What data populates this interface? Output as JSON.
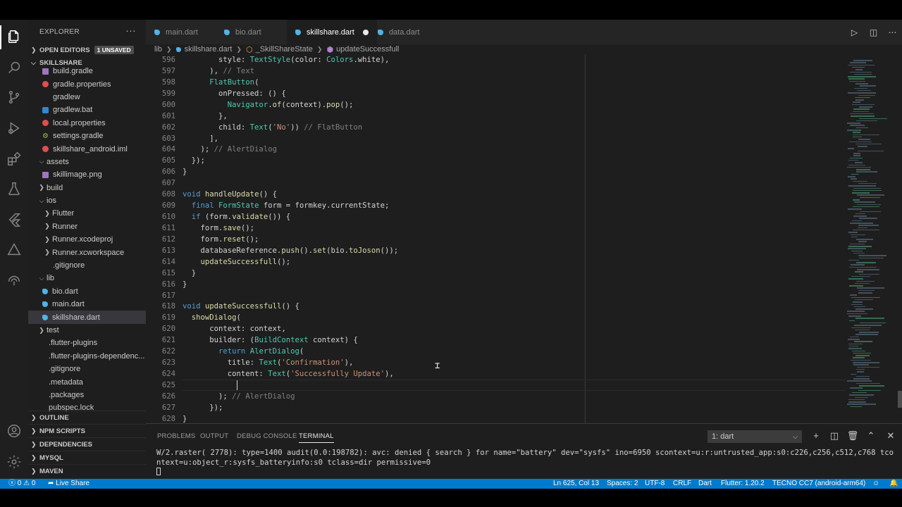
{
  "sidebar": {
    "title": "EXPLORER",
    "more": "···",
    "open_editors": {
      "label": "OPEN EDITORS",
      "badge": "1 UNSAVED"
    },
    "project": "SKILLSHARE",
    "tree": [
      {
        "label": "build.gradle",
        "icon": "gradle-icon",
        "depth": 2
      },
      {
        "label": "gradle.properties",
        "icon": "properties-icon",
        "depth": 2
      },
      {
        "label": "gradlew",
        "icon": "file-icon",
        "depth": 2
      },
      {
        "label": "gradlew.bat",
        "icon": "bat-icon",
        "depth": 2
      },
      {
        "label": "local.properties",
        "icon": "properties-icon",
        "depth": 2
      },
      {
        "label": "settings.gradle",
        "icon": "gear-icon",
        "depth": 2
      },
      {
        "label": "skillshare_android.iml",
        "icon": "iml-icon",
        "depth": 2
      },
      {
        "label": "assets",
        "icon": "folder-open-chevron",
        "depth": 1
      },
      {
        "label": "skillimage.png",
        "icon": "image-icon",
        "depth": 2
      },
      {
        "label": "build",
        "icon": "folder-closed-chevron",
        "depth": 1
      },
      {
        "label": "ios",
        "icon": "folder-open-chevron",
        "depth": 1
      },
      {
        "label": "Flutter",
        "icon": "folder-closed-chevron",
        "depth": 2
      },
      {
        "label": "Runner",
        "icon": "folder-closed-chevron",
        "depth": 2
      },
      {
        "label": "Runner.xcodeproj",
        "icon": "folder-closed-chevron",
        "depth": 2
      },
      {
        "label": "Runner.xcworkspace",
        "icon": "folder-closed-chevron",
        "depth": 2
      },
      {
        "label": ".gitignore",
        "icon": "file-icon",
        "depth": 2
      },
      {
        "label": "lib",
        "icon": "folder-open-chevron",
        "depth": 1
      },
      {
        "label": "bio.dart",
        "icon": "dart-icon",
        "depth": 2
      },
      {
        "label": "main.dart",
        "icon": "dart-icon",
        "depth": 2
      },
      {
        "label": "skillshare.dart",
        "icon": "dart-icon",
        "depth": 2,
        "selected": true
      },
      {
        "label": "test",
        "icon": "folder-closed-chevron",
        "depth": 1
      },
      {
        "label": ".flutter-plugins",
        "icon": "file-icon",
        "depth": 1
      },
      {
        "label": ".flutter-plugins-dependenc...",
        "icon": "file-icon",
        "depth": 1
      },
      {
        "label": ".gitignore",
        "icon": "file-icon",
        "depth": 1
      },
      {
        "label": ".metadata",
        "icon": "file-icon",
        "depth": 1
      },
      {
        "label": ".packages",
        "icon": "file-icon",
        "depth": 1
      },
      {
        "label": "pubspec.lock",
        "icon": "file-icon",
        "depth": 1
      }
    ],
    "sections": [
      "OUTLINE",
      "NPM SCRIPTS",
      "DEPENDENCIES",
      "MYSQL",
      "MAVEN"
    ]
  },
  "tabs": [
    {
      "label": "main.dart",
      "active": false
    },
    {
      "label": "bio.dart",
      "active": false
    },
    {
      "label": "skillshare.dart",
      "active": true,
      "dirty": true
    },
    {
      "label": "data.dart",
      "active": false
    }
  ],
  "breadcrumb": [
    "lib",
    "skillshare.dart",
    "_SkillShareState",
    "updateSuccessfull"
  ],
  "editor": {
    "lines": [
      {
        "n": "596",
        "t": [
          [
            "        style: ",
            ""
          ],
          [
            "TextStyle",
            "ty"
          ],
          [
            "(color: ",
            ""
          ],
          [
            "Colors",
            "ty"
          ],
          [
            ".white),",
            ""
          ]
        ]
      },
      {
        "n": "597",
        "t": [
          [
            "      ), ",
            ""
          ],
          [
            "// Text",
            "cmh"
          ]
        ]
      },
      {
        "n": "598",
        "t": [
          [
            "      ",
            ""
          ],
          [
            "FlatButton",
            "ty"
          ],
          [
            "(",
            ""
          ]
        ]
      },
      {
        "n": "599",
        "t": [
          [
            "        onPressed: () {",
            ""
          ]
        ]
      },
      {
        "n": "600",
        "t": [
          [
            "          ",
            ""
          ],
          [
            "Navigator",
            "ty"
          ],
          [
            ".",
            ""
          ],
          [
            "of",
            "fn"
          ],
          [
            "(context).",
            ""
          ],
          [
            "pop",
            "fn"
          ],
          [
            "();",
            ""
          ]
        ]
      },
      {
        "n": "601",
        "t": [
          [
            "        },",
            ""
          ]
        ]
      },
      {
        "n": "602",
        "t": [
          [
            "        child: ",
            ""
          ],
          [
            "Text",
            "ty"
          ],
          [
            "(",
            ""
          ],
          [
            "'No'",
            "st"
          ],
          [
            ")) ",
            ""
          ],
          [
            "// FlatButton",
            "cmh"
          ]
        ]
      },
      {
        "n": "603",
        "t": [
          [
            "      ],",
            ""
          ]
        ]
      },
      {
        "n": "604",
        "t": [
          [
            "    ); ",
            ""
          ],
          [
            "// AlertDialog",
            "cmh"
          ]
        ]
      },
      {
        "n": "605",
        "t": [
          [
            "  });",
            ""
          ]
        ]
      },
      {
        "n": "606",
        "t": [
          [
            "}",
            ""
          ]
        ]
      },
      {
        "n": "607",
        "t": [
          [
            "",
            ""
          ]
        ]
      },
      {
        "n": "608",
        "t": [
          [
            "void",
            "kw"
          ],
          [
            " ",
            ""
          ],
          [
            "handleUpdate",
            "fn"
          ],
          [
            "() {",
            ""
          ]
        ]
      },
      {
        "n": "609",
        "t": [
          [
            "  ",
            ""
          ],
          [
            "final",
            "kw"
          ],
          [
            " ",
            ""
          ],
          [
            "FormState",
            "ty"
          ],
          [
            " form = formkey.currentState;",
            ""
          ]
        ]
      },
      {
        "n": "610",
        "t": [
          [
            "  ",
            ""
          ],
          [
            "if",
            "kw"
          ],
          [
            " (form.",
            ""
          ],
          [
            "validate",
            "fn"
          ],
          [
            "()) {",
            ""
          ]
        ]
      },
      {
        "n": "611",
        "t": [
          [
            "    form.",
            ""
          ],
          [
            "save",
            "fn"
          ],
          [
            "();",
            ""
          ]
        ]
      },
      {
        "n": "612",
        "t": [
          [
            "    form.",
            ""
          ],
          [
            "reset",
            "fn"
          ],
          [
            "();",
            ""
          ]
        ]
      },
      {
        "n": "613",
        "t": [
          [
            "    databaseReference.",
            ""
          ],
          [
            "push",
            "fn"
          ],
          [
            "().",
            ""
          ],
          [
            "set",
            "fn"
          ],
          [
            "(bio.",
            ""
          ],
          [
            "toJoson",
            "fn"
          ],
          [
            "());",
            ""
          ]
        ]
      },
      {
        "n": "614",
        "t": [
          [
            "    ",
            ""
          ],
          [
            "updateSuccessfull",
            "fn"
          ],
          [
            "();",
            ""
          ]
        ]
      },
      {
        "n": "615",
        "t": [
          [
            "  }",
            ""
          ]
        ]
      },
      {
        "n": "616",
        "t": [
          [
            "}",
            ""
          ]
        ]
      },
      {
        "n": "617",
        "t": [
          [
            "",
            ""
          ]
        ]
      },
      {
        "n": "618",
        "t": [
          [
            "void",
            "kw"
          ],
          [
            " ",
            ""
          ],
          [
            "updateSuccessfull",
            "fn"
          ],
          [
            "() {",
            ""
          ]
        ]
      },
      {
        "n": "619",
        "t": [
          [
            "  ",
            ""
          ],
          [
            "showDialog",
            "fn"
          ],
          [
            "(",
            ""
          ]
        ]
      },
      {
        "n": "620",
        "t": [
          [
            "      context: context,",
            ""
          ]
        ]
      },
      {
        "n": "621",
        "t": [
          [
            "      builder: (",
            ""
          ],
          [
            "BuildContext",
            "ty"
          ],
          [
            " context) {",
            ""
          ]
        ]
      },
      {
        "n": "622",
        "t": [
          [
            "        ",
            ""
          ],
          [
            "return",
            "kw"
          ],
          [
            " ",
            ""
          ],
          [
            "AlertDialog",
            "ty"
          ],
          [
            "(",
            ""
          ]
        ]
      },
      {
        "n": "623",
        "t": [
          [
            "          title: ",
            ""
          ],
          [
            "Text",
            "ty"
          ],
          [
            "(",
            ""
          ],
          [
            "'Confirmation'",
            "st"
          ],
          [
            "),",
            ""
          ]
        ]
      },
      {
        "n": "624",
        "t": [
          [
            "          content: ",
            ""
          ],
          [
            "Text",
            "ty"
          ],
          [
            "(",
            ""
          ],
          [
            "'Successfully Update'",
            "st"
          ],
          [
            "),",
            ""
          ]
        ]
      },
      {
        "n": "625",
        "t": [
          [
            "          ",
            ""
          ]
        ],
        "current": true
      },
      {
        "n": "626",
        "t": [
          [
            "        ); ",
            ""
          ],
          [
            "// AlertDialog",
            "cmh"
          ]
        ]
      },
      {
        "n": "627",
        "t": [
          [
            "      });",
            ""
          ]
        ]
      },
      {
        "n": "628",
        "t": [
          [
            "}",
            ""
          ]
        ]
      }
    ]
  },
  "panel": {
    "tabs": [
      "PROBLEMS",
      "OUTPUT",
      "DEBUG CONSOLE",
      "TERMINAL"
    ],
    "active_tab": "TERMINAL",
    "terminal_select": "1: dart",
    "terminal_output": "W/2.raster( 2778): type=1400 audit(0.0:198782): avc: denied { search } for name=\"battery\" dev=\"sysfs\" ino=6950 scontext=u:r:untrusted_app:s0:c226,c256,c512,c768 tcontext=u:object_r:sysfs_batteryinfo:s0 tclass=dir permissive=0"
  },
  "statusbar": {
    "errors": "0",
    "warnings": "0",
    "live_share": "Live Share",
    "position": "Ln 625, Col 13",
    "spaces": "Spaces: 2",
    "encoding": "UTF-8",
    "eol": "CRLF",
    "language": "Dart",
    "flutter": "Flutter: 1.20.2",
    "device": "TECNO CC7 (android-arm64)"
  },
  "colors": {
    "statusbar": "#007acc",
    "editor_bg": "#1e1e1e",
    "sidebar_bg": "#1e1e1e",
    "tabbar_bg": "#252526"
  }
}
